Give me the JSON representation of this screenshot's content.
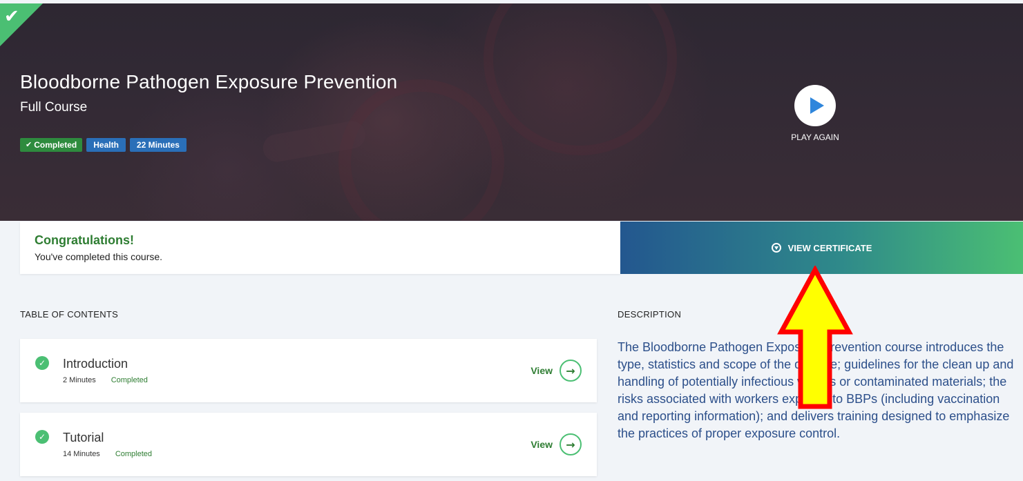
{
  "hero": {
    "title": "Bloodborne Pathogen Exposure Prevention",
    "subtitle": "Full Course",
    "badges": [
      {
        "label": "Completed",
        "icon": "check-icon",
        "color": "#2e8b3e"
      },
      {
        "label": "Health",
        "color": "#2a6fb8"
      },
      {
        "label": "22 Minutes",
        "color": "#2a6fb8"
      }
    ],
    "play_label": "PLAY AGAIN",
    "completed_corner_icon": "check-icon"
  },
  "congrats": {
    "title": "Congratulations!",
    "text": "You've completed this course."
  },
  "certificate": {
    "label": "VIEW CERTIFICATE",
    "icon": "download-circle-icon"
  },
  "toc": {
    "heading": "TABLE OF CONTENTS",
    "items": [
      {
        "title": "Introduction",
        "duration": "2 Minutes",
        "status": "Completed",
        "action": "View"
      },
      {
        "title": "Tutorial",
        "duration": "14 Minutes",
        "status": "Completed",
        "action": "View"
      }
    ]
  },
  "description": {
    "heading": "DESCRIPTION",
    "text": "The Bloodborne Pathogen Exposure Prevention course introduces the type, statistics and scope of the disease; guidelines for the clean up and handling of potentially infectious wastes or contaminated materials; the risks associated with workers exposed to BBPs (including vaccination and reporting information); and delivers training designed to emphasize the practices of proper exposure control."
  },
  "colors": {
    "accent_green": "#4bbf73",
    "text_green": "#2e7d32",
    "badge_blue": "#2a6fb8",
    "description_blue": "#2c4f8a",
    "annotation_arrow": "#ffff00",
    "annotation_outline": "#ff0000"
  }
}
